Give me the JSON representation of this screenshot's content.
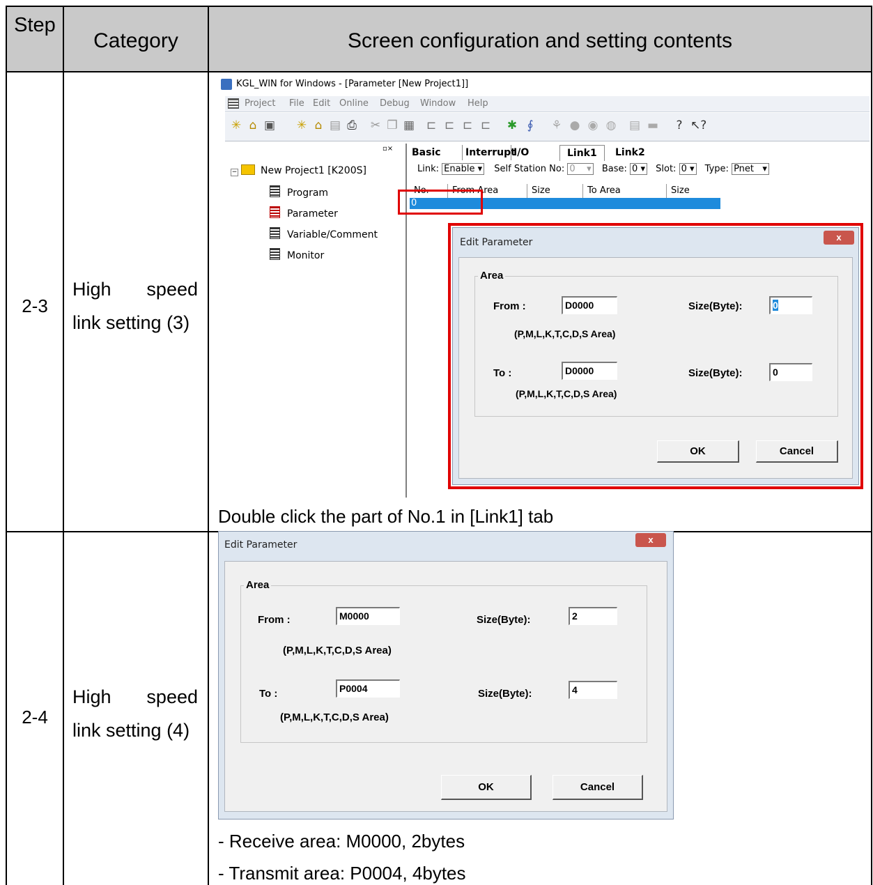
{
  "table": {
    "headers": {
      "step": "Step",
      "category": "Category",
      "content": "Screen configuration and setting contents"
    },
    "rows": [
      {
        "step": "2-3",
        "category_line1": "High speed",
        "category_line2": "link setting (3)",
        "caption": "Double click the part of No.1 in [Link1] tab"
      },
      {
        "step": "2-4",
        "category_line1": "High speed",
        "category_line2": "link setting (4)",
        "notes": [
          "- Receive area: M0000, 2bytes",
          "- Transmit area: P0004, 4bytes"
        ]
      }
    ]
  },
  "app": {
    "title": "KGL_WIN for Windows - [Parameter [New Project1]]",
    "menu": [
      "Project",
      "File",
      "Edit",
      "Online",
      "Debug",
      "Window",
      "Help"
    ],
    "tree": {
      "root": "New Project1 [K200S]",
      "items": [
        "Program",
        "Parameter",
        "Variable/Comment",
        "Monitor"
      ]
    },
    "tabs": [
      "Basic",
      "Interrupt",
      "I/O",
      "Link1",
      "Link2"
    ],
    "link_settings": {
      "link_label": "Link:",
      "link_value": "Enable",
      "station_label": "Self Station No:",
      "station_value": "0",
      "base_label": "Base:",
      "base_value": "0",
      "slot_label": "Slot:",
      "slot_value": "0",
      "type_label": "Type:",
      "type_value": "Pnet"
    },
    "grid_headers": [
      "No.",
      "From Area",
      "Size",
      "To Area",
      "Size"
    ],
    "selected_row_no": "0"
  },
  "dialog1": {
    "title": "Edit Parameter",
    "close": "x",
    "group": "Area",
    "from_label": "From :",
    "from_value": "D0000",
    "from_size_label": "Size(Byte):",
    "from_size_value": "0",
    "hint": "(P,M,L,K,T,C,D,S Area)",
    "to_label": "To :",
    "to_value": "D0000",
    "to_size_label": "Size(Byte):",
    "to_size_value": "0",
    "ok": "OK",
    "cancel": "Cancel"
  },
  "dialog2": {
    "title": "Edit Parameter",
    "close": "x",
    "group": "Area",
    "from_label": "From :",
    "from_value": "M0000",
    "from_size_label": "Size(Byte):",
    "from_size_value": "2",
    "hint": "(P,M,L,K,T,C,D,S Area)",
    "to_label": "To :",
    "to_value": "P0004",
    "to_size_label": "Size(Byte):",
    "to_size_value": "4",
    "ok": "OK",
    "cancel": "Cancel"
  },
  "colors": {
    "header_bg": "#c9c9c9",
    "highlight": "#e00000",
    "selection": "#1e8bdc"
  }
}
